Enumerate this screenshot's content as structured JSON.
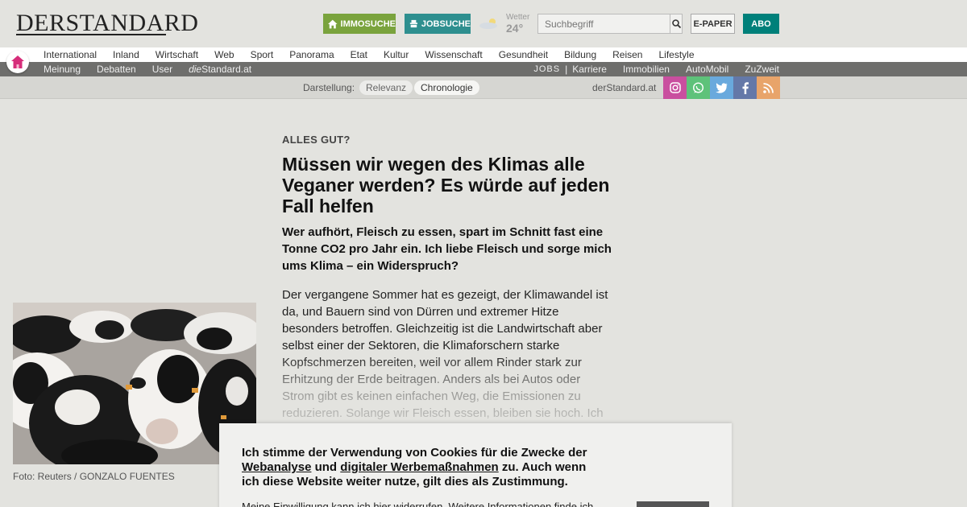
{
  "header": {
    "logo": "DERSTANDARD",
    "immosuche": "IMMOSUCHE",
    "jobsuche": "JOBSUCHE",
    "weather_label": "Wetter",
    "weather_temp": "24°",
    "search_placeholder": "Suchbegriff",
    "epaper": "E-PAPER",
    "abo": "ABO"
  },
  "nav_primary": [
    "International",
    "Inland",
    "Wirtschaft",
    "Web",
    "Sport",
    "Panorama",
    "Etat",
    "Kultur",
    "Wissenschaft",
    "Gesundheit",
    "Bildung",
    "Reisen",
    "Lifestyle"
  ],
  "nav_secondary": {
    "left": [
      "Meinung",
      "Debatten",
      "User"
    ],
    "diestandard_prefix": "die",
    "diestandard_suffix": "Standard.at",
    "jobs": "JOBS",
    "separator": "|",
    "right": [
      "Karriere",
      "Immobilien",
      "AutoMobil",
      "ZuZweit"
    ]
  },
  "view_bar": {
    "label": "Darstellung:",
    "options": [
      "Relevanz",
      "Chronologie"
    ],
    "selected": "Chronologie",
    "site": "derStandard.at"
  },
  "social": [
    {
      "icon": "instagram-icon",
      "color": "#c94f9f"
    },
    {
      "icon": "whatsapp-icon",
      "color": "#5ec27a"
    },
    {
      "icon": "twitter-icon",
      "color": "#69a9dd"
    },
    {
      "icon": "facebook-icon",
      "color": "#6478a8"
    },
    {
      "icon": "rss-icon",
      "color": "#e8a46a"
    }
  ],
  "article": {
    "kicker": "ALLES GUT?",
    "headline": "Müssen wir wegen des Klimas alle Veganer werden? Es würde auf jeden Fall helfen",
    "lead": "Wer aufhört, Fleisch zu essen, spart im Schnitt fast eine Tonne CO2 pro Jahr ein. Ich liebe Fleisch und sorge mich ums Klima – ein Widerspruch?",
    "body": "Der vergangene Sommer hat es gezeigt, der Klimawandel ist da, und Bauern sind von Dürren und extremer Hitze besonders betroffen. Gleichzeitig ist die Landwirtschaft aber selbst einer der Sektoren, die Klimaforschern starke Kopfschmerzen bereiten, weil vor allem Rinder stark zur Erhitzung der Erde beitragen. Anders als bei Autos oder Strom gibt es keinen einfachen Weg, die Emissionen zu reduzieren. Solange wir Fleisch essen, bleiben sie hoch. Ich",
    "photo_caption": "Foto: Reuters / GONZALO FUENTES"
  },
  "cookie": {
    "line_a": "Ich stimme der Verwendung von Cookies für die Zwecke der",
    "link1": "Webanalyse",
    "and": "und",
    "link2": "digitaler Werbemaßnahmen",
    "line_b": "zu. Auch wenn ich diese Website weiter nutze, gilt dies als Zustimmung.",
    "sub": "Meine Einwilligung kann ich hier widerrufen. Weitere Informationen finde ich"
  }
}
